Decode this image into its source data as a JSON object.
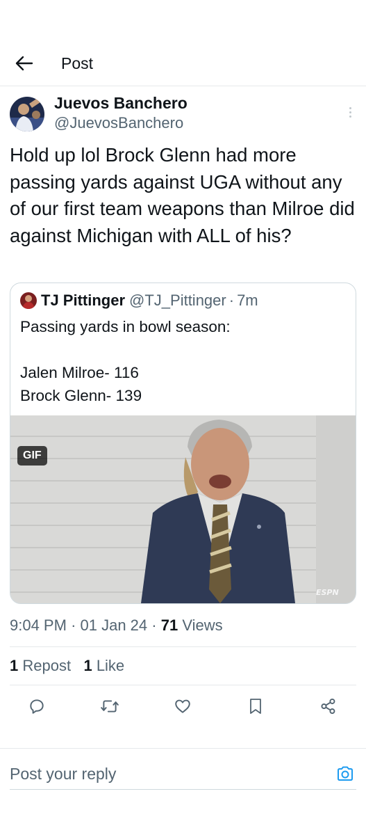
{
  "header": {
    "title": "Post",
    "back_icon": "arrow-left-icon"
  },
  "post": {
    "author_name": "Juevos Banchero",
    "author_handle": "@JuevosBanchero",
    "text": "Hold up lol Brock Glenn had more passing yards against UGA without any of our first team weapons than Milroe did against Michigan with ALL of his?",
    "time": "9:04 PM",
    "date": "01 Jan 24",
    "views_count": "71",
    "views_label": "Views",
    "reposts_count": "1",
    "reposts_label": "Repost",
    "likes_count": "1",
    "likes_label": "Like"
  },
  "quoted_post": {
    "author_name": "TJ Pittinger",
    "author_handle": "@TJ_Pittinger",
    "time_ago": "7m",
    "text": "Passing yards in bowl season:\n\nJalen Milroe- 116\nBrock Glenn- 139",
    "media_badge": "GIF",
    "media_watermark": "ESPN"
  },
  "actions": [
    "reply-icon",
    "repost-icon",
    "like-icon",
    "bookmark-icon",
    "share-icon"
  ],
  "reply": {
    "placeholder": "Post your reply",
    "camera_icon": "camera-icon"
  },
  "colors": {
    "text_primary": "#0f1419",
    "text_secondary": "#536471",
    "accent": "#1d9bf0",
    "border": "#e6e9eb"
  }
}
